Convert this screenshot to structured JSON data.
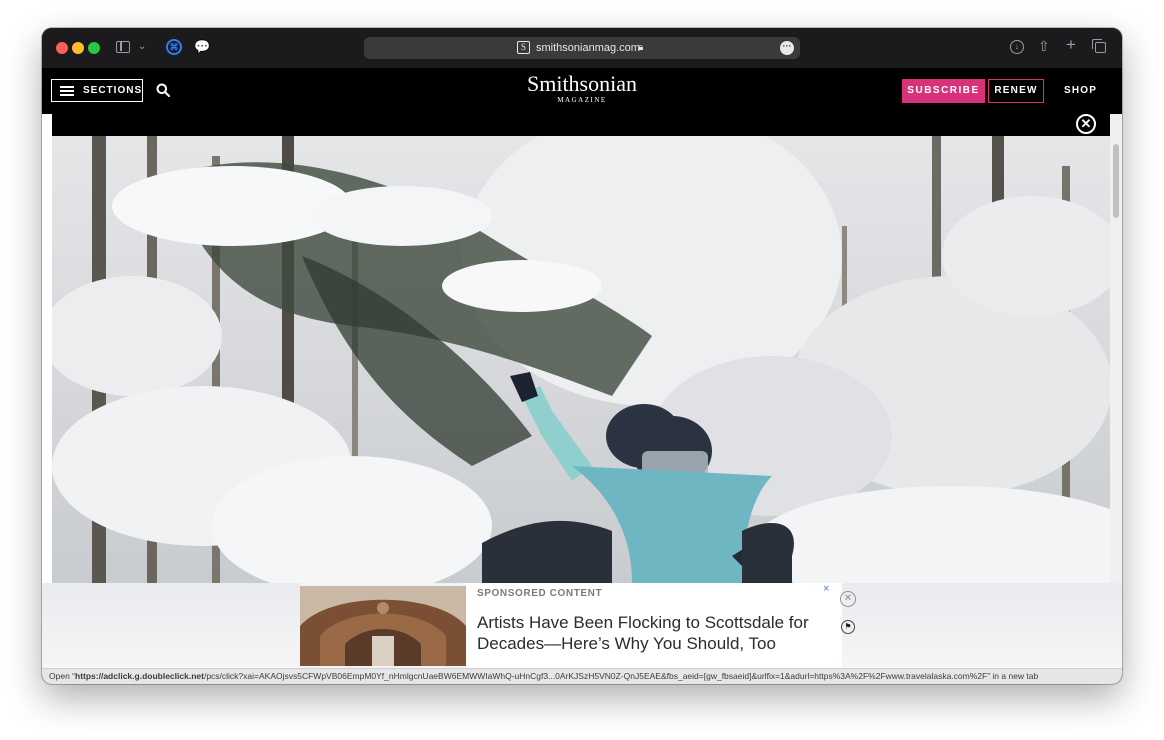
{
  "browser": {
    "url": "smithsonianmag.com",
    "site_favicon": "S",
    "icons": {
      "sidebar": "sidebar-icon",
      "extension": "extension-icon",
      "chat": "chat-icon",
      "lock": "lock-icon",
      "more": "ellipsis-icon",
      "download": "download-icon",
      "share": "share-icon",
      "new_tab": "plus-icon",
      "tab_overview": "tabs-icon"
    }
  },
  "header": {
    "sections_label": "SECTIONS",
    "logo_main": "Smithsonian",
    "logo_sub": "MAGAZINE",
    "subscribe_label": "SUBSCRIBE",
    "renew_label": "RENEW",
    "shop_label": "SHOP",
    "accent_color": "#d8337a"
  },
  "ad": {
    "kicker": "SPONSORED CONTENT",
    "headline": "Artists Have Been Flocking to Scottsdale for Decades—Here’s Why You Should, Too",
    "adchoices_x": "×",
    "close_symbol": "✕",
    "flag_symbol": "⚑"
  },
  "status": {
    "prefix": "Open “",
    "url_bold": "https://adclick.g.doubleclick.net",
    "url_rest": "/pcs/click?xai=AKAOjsvs5CFWpVB06EmpM0Yf_nHmlgcnUaeBW6EMWWIaWhQ-uHnCgf3...0ArKJSzH5VN0Z-QnJ5EAE&fbs_aeid=[gw_fbsaeid]&urlfix=1&adurl=https%3A%2F%2Fwww.travelalaska.com%2F",
    "suffix": "” in a new tab"
  }
}
